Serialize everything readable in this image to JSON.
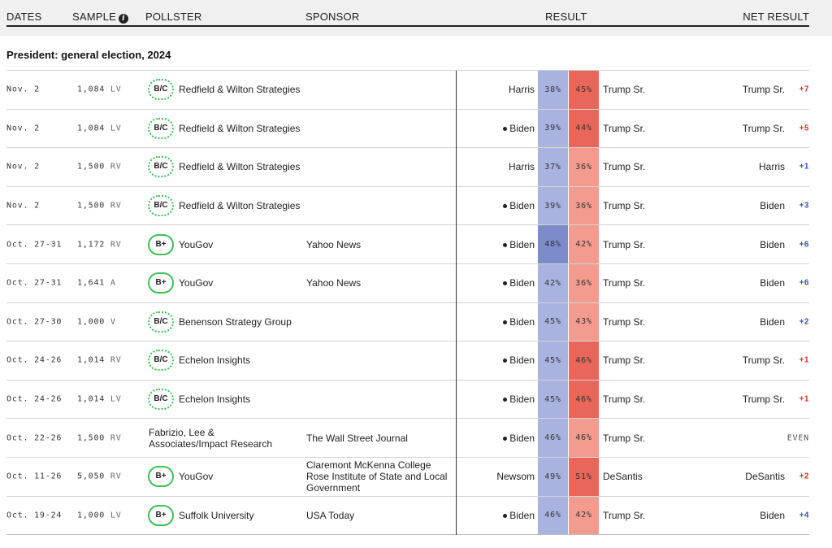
{
  "header": {
    "dates": "DATES",
    "sample": "SAMPLE",
    "pollster": "POLLSTER",
    "sponsor": "SPONSOR",
    "result": "RESULT",
    "net_result": "NET RESULT",
    "info_icon": "info-icon"
  },
  "section_title": "President: general election, 2024",
  "colors": {
    "grade_border": "#3fbf5a",
    "dem_strong": "#7b8bcc",
    "dem_light": "#a9b3e0",
    "rep_strong": "#e8675a",
    "rep_light": "#f29b8e",
    "rep_margin": "#d8322c",
    "dem_margin": "#3a55b0"
  },
  "rows": [
    {
      "date": "Nov. 2",
      "sample_n": "1,084",
      "sample_type": "LV",
      "grade": "B/C",
      "grade_style": "dotted",
      "pollster": "Redfield & Wilton Strategies",
      "sponsor": "",
      "cand1": "Harris",
      "cand1_dot": false,
      "pct1": "38%",
      "pct1_strong": false,
      "pct2": "45%",
      "pct2_strong": true,
      "cand2": "Trump Sr.",
      "net_leader": "Trump Sr.",
      "net_margin": "+7",
      "net_party": "rep"
    },
    {
      "date": "Nov. 2",
      "sample_n": "1,084",
      "sample_type": "LV",
      "grade": "B/C",
      "grade_style": "dotted",
      "pollster": "Redfield & Wilton Strategies",
      "sponsor": "",
      "cand1": "Biden",
      "cand1_dot": true,
      "pct1": "39%",
      "pct1_strong": false,
      "pct2": "44%",
      "pct2_strong": true,
      "cand2": "Trump Sr.",
      "net_leader": "Trump Sr.",
      "net_margin": "+5",
      "net_party": "rep"
    },
    {
      "date": "Nov. 2",
      "sample_n": "1,500",
      "sample_type": "RV",
      "grade": "B/C",
      "grade_style": "dotted",
      "pollster": "Redfield & Wilton Strategies",
      "sponsor": "",
      "cand1": "Harris",
      "cand1_dot": false,
      "pct1": "37%",
      "pct1_strong": false,
      "pct2": "36%",
      "pct2_strong": false,
      "cand2": "Trump Sr.",
      "net_leader": "Harris",
      "net_margin": "+1",
      "net_party": "dem"
    },
    {
      "date": "Nov. 2",
      "sample_n": "1,500",
      "sample_type": "RV",
      "grade": "B/C",
      "grade_style": "dotted",
      "pollster": "Redfield & Wilton Strategies",
      "sponsor": "",
      "cand1": "Biden",
      "cand1_dot": true,
      "pct1": "39%",
      "pct1_strong": false,
      "pct2": "36%",
      "pct2_strong": false,
      "cand2": "Trump Sr.",
      "net_leader": "Biden",
      "net_margin": "+3",
      "net_party": "dem"
    },
    {
      "date": "Oct. 27-31",
      "sample_n": "1,172",
      "sample_type": "RV",
      "grade": "B+",
      "grade_style": "solid",
      "pollster": "YouGov",
      "sponsor": "Yahoo News",
      "cand1": "Biden",
      "cand1_dot": true,
      "pct1": "48%",
      "pct1_strong": true,
      "pct2": "42%",
      "pct2_strong": false,
      "cand2": "Trump Sr.",
      "net_leader": "Biden",
      "net_margin": "+6",
      "net_party": "dem"
    },
    {
      "date": "Oct. 27-31",
      "sample_n": "1,641",
      "sample_type": "A",
      "grade": "B+",
      "grade_style": "solid",
      "pollster": "YouGov",
      "sponsor": "Yahoo News",
      "cand1": "Biden",
      "cand1_dot": true,
      "pct1": "42%",
      "pct1_strong": false,
      "pct2": "36%",
      "pct2_strong": false,
      "cand2": "Trump Sr.",
      "net_leader": "Biden",
      "net_margin": "+6",
      "net_party": "dem"
    },
    {
      "date": "Oct. 27-30",
      "sample_n": "1,000",
      "sample_type": "V",
      "grade": "B/C",
      "grade_style": "dotted",
      "pollster": "Benenson Strategy Group",
      "sponsor": "",
      "cand1": "Biden",
      "cand1_dot": true,
      "pct1": "45%",
      "pct1_strong": false,
      "pct2": "43%",
      "pct2_strong": false,
      "cand2": "Trump Sr.",
      "net_leader": "Biden",
      "net_margin": "+2",
      "net_party": "dem"
    },
    {
      "date": "Oct. 24-26",
      "sample_n": "1,014",
      "sample_type": "RV",
      "grade": "B/C",
      "grade_style": "dotted",
      "pollster": "Echelon Insights",
      "sponsor": "",
      "cand1": "Biden",
      "cand1_dot": true,
      "pct1": "45%",
      "pct1_strong": false,
      "pct2": "46%",
      "pct2_strong": true,
      "cand2": "Trump Sr.",
      "net_leader": "Trump Sr.",
      "net_margin": "+1",
      "net_party": "rep"
    },
    {
      "date": "Oct. 24-26",
      "sample_n": "1,014",
      "sample_type": "LV",
      "grade": "B/C",
      "grade_style": "dotted",
      "pollster": "Echelon Insights",
      "sponsor": "",
      "cand1": "Biden",
      "cand1_dot": true,
      "pct1": "45%",
      "pct1_strong": false,
      "pct2": "46%",
      "pct2_strong": true,
      "cand2": "Trump Sr.",
      "net_leader": "Trump Sr.",
      "net_margin": "+1",
      "net_party": "rep"
    },
    {
      "date": "Oct. 22-26",
      "sample_n": "1,500",
      "sample_type": "RV",
      "grade": "",
      "grade_style": "none",
      "pollster": "Fabrizio, Lee & Associates/Impact Research",
      "sponsor": "The Wall Street Journal",
      "cand1": "Biden",
      "cand1_dot": true,
      "pct1": "46%",
      "pct1_strong": false,
      "pct2": "46%",
      "pct2_strong": false,
      "cand2": "Trump Sr.",
      "net_leader": "",
      "net_margin": "EVEN",
      "net_party": "even"
    },
    {
      "date": "Oct. 11-26",
      "sample_n": "5,050",
      "sample_type": "RV",
      "grade": "B+",
      "grade_style": "solid",
      "pollster": "YouGov",
      "sponsor": "Claremont McKenna College Rose Institute of State and Local Government",
      "cand1": "Newsom",
      "cand1_dot": false,
      "pct1": "49%",
      "pct1_strong": false,
      "pct2": "51%",
      "pct2_strong": true,
      "cand2": "DeSantis",
      "net_leader": "DeSantis",
      "net_margin": "+2",
      "net_party": "rep"
    },
    {
      "date": "Oct. 19-24",
      "sample_n": "1,000",
      "sample_type": "LV",
      "grade": "B+",
      "grade_style": "solid",
      "pollster": "Suffolk University",
      "sponsor": "USA Today",
      "cand1": "Biden",
      "cand1_dot": true,
      "pct1": "46%",
      "pct1_strong": false,
      "pct2": "42%",
      "pct2_strong": false,
      "cand2": "Trump Sr.",
      "net_leader": "Biden",
      "net_margin": "+4",
      "net_party": "dem"
    }
  ]
}
